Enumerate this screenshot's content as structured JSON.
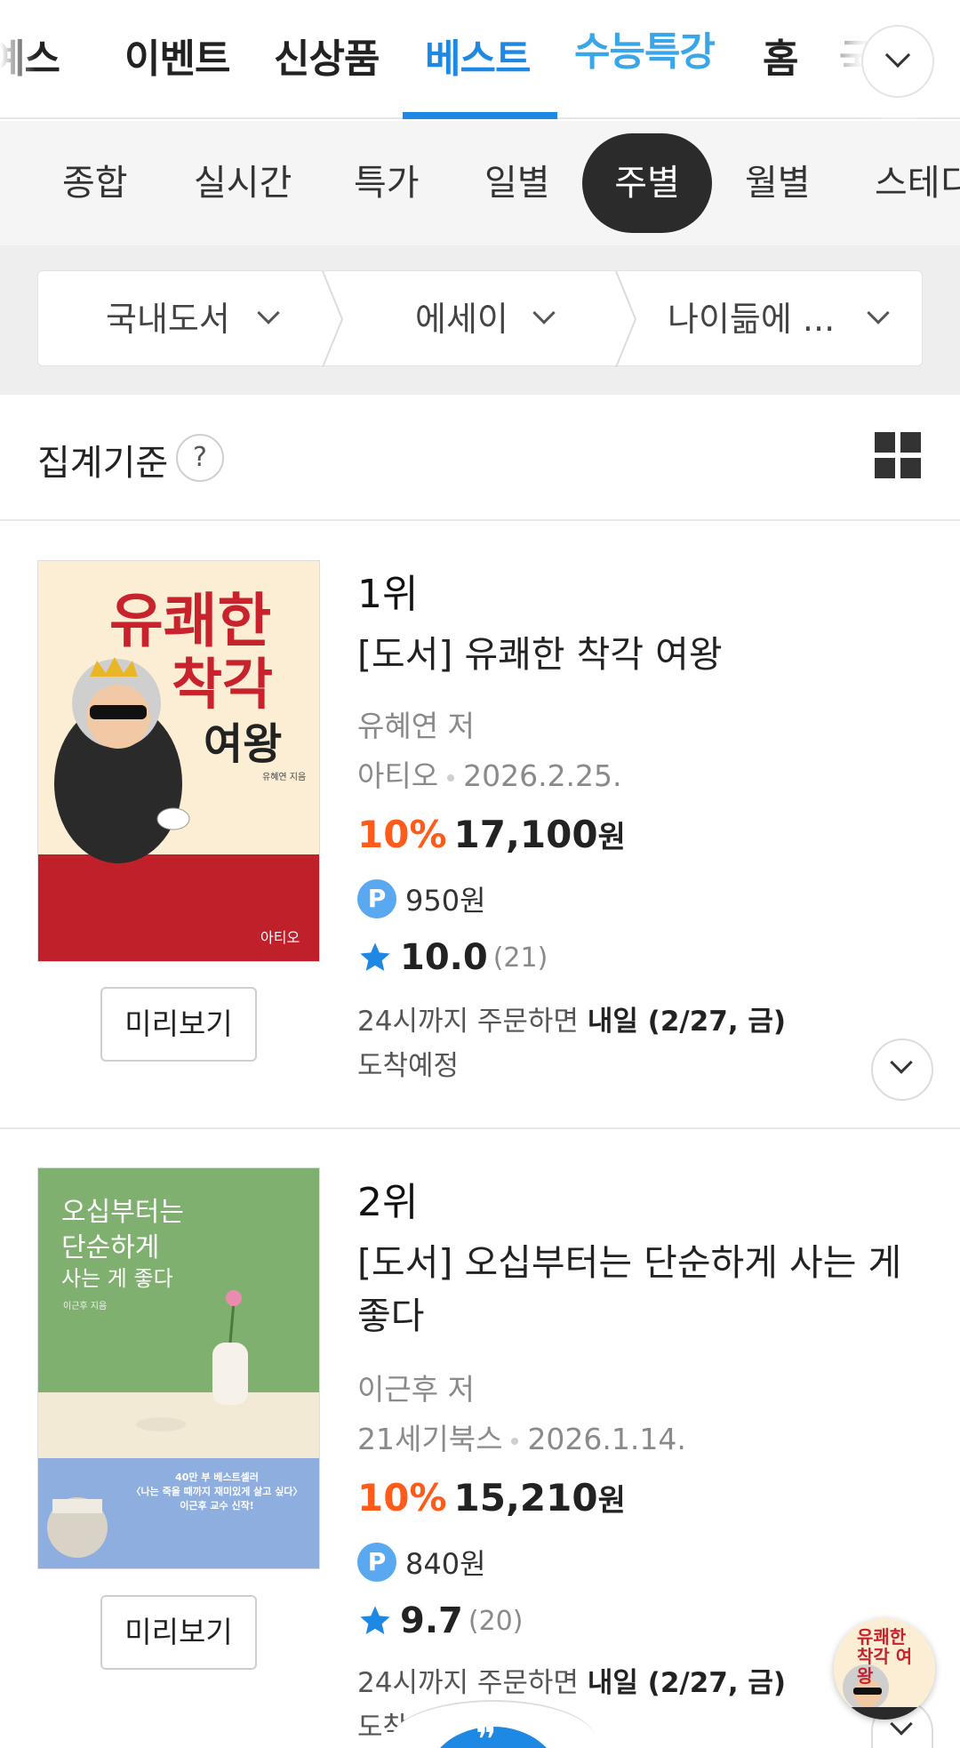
{
  "top_tabs": {
    "items": [
      "예스",
      "이벤트",
      "신상품",
      "베스트",
      "수능특강",
      "홈",
      "국"
    ],
    "expand_icon": "chevron-down-icon"
  },
  "period_tabs": {
    "items": [
      "종합",
      "실시간",
      "특가",
      "일별",
      "주별",
      "월별",
      "스테디"
    ],
    "active": "주별"
  },
  "categories": {
    "items": [
      "국내도서",
      "에세이",
      "나이듦에 ..."
    ],
    "icon": "chevron-down-icon"
  },
  "aggregation": {
    "label": "집계기준",
    "help": "?",
    "view_icon": "grid-view-icon"
  },
  "books": [
    {
      "rank": "1위",
      "title": "[도서] 유쾌한 착각 여왕",
      "author": "유혜연 저",
      "publisher": "아티오",
      "date": "2026.2.25.",
      "discount": "10%",
      "price": "17,100",
      "won": "원",
      "points": "950원",
      "rating": "10.0",
      "review_count": "(21)",
      "delivery_prefix": "24시까지 주문하면",
      "delivery_date": "내일 (2/27, 금)",
      "delivery_suffix": "도착예정",
      "preview_label": "미리보기",
      "cover": {
        "title_line1": "유쾌한",
        "title_line2": "착각",
        "title_line3": "여왕",
        "author": "유혜연 지음",
        "publisher_logo": "아티오",
        "bg_top": "#fbeed5",
        "bg_bottom": "#c0202a"
      }
    },
    {
      "rank": "2위",
      "title": "[도서] 오십부터는 단순하게 사는 게 좋다",
      "author": "이근후 저",
      "publisher": "21세기북스",
      "date": "2026.1.14.",
      "discount": "10%",
      "price": "15,210",
      "won": "원",
      "points": "840원",
      "rating": "9.7",
      "review_count": "(20)",
      "delivery_prefix": "24시까지 주문하면",
      "delivery_date": "내일 (2/27, 금)",
      "delivery_suffix": "도착예정",
      "preview_label": "미리보기",
      "cover": {
        "title_line1": "오십부터는",
        "title_line2": "단순하게",
        "title_line3": "사는 게 좋다",
        "author": "이근후 지음",
        "banner_line1": "40만 부 베스트셀러",
        "banner_line2": "〈나는 죽을 때까지 재미있게 살고 싶다〉",
        "banner_line3": "이근후 교수 신작!",
        "bg_top": "#7fb070",
        "bg_mid": "#f3ead6",
        "bg_bottom": "#8faee0"
      }
    }
  ],
  "colors": {
    "accent": "#1e88e5",
    "discount": "#ff5b1a",
    "star": "#1e88e5",
    "point": "#5aa8f0"
  },
  "floating": {
    "thumb_text": "유쾌한 착각 여왕"
  }
}
